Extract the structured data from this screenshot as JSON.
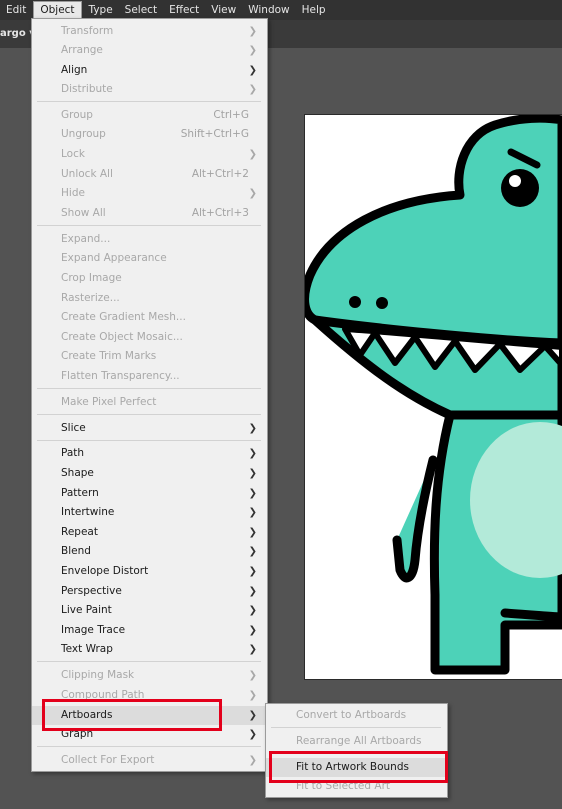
{
  "menubar": {
    "items": [
      "Edit",
      "Object",
      "Type",
      "Select",
      "Effect",
      "View",
      "Window",
      "Help"
    ],
    "active": "Object"
  },
  "document_tab": {
    "label": "argo v"
  },
  "object_menu": {
    "transform": "Transform",
    "arrange": "Arrange",
    "align": "Align",
    "distribute": "Distribute",
    "group": "Group",
    "group_sc": "Ctrl+G",
    "ungroup": "Ungroup",
    "ungroup_sc": "Shift+Ctrl+G",
    "lock": "Lock",
    "unlock_all": "Unlock All",
    "unlock_all_sc": "Alt+Ctrl+2",
    "hide": "Hide",
    "show_all": "Show All",
    "show_all_sc": "Alt+Ctrl+3",
    "expand": "Expand...",
    "expand_appearance": "Expand Appearance",
    "crop_image": "Crop Image",
    "rasterize": "Rasterize...",
    "create_gradient_mesh": "Create Gradient Mesh...",
    "create_object_mosaic": "Create Object Mosaic...",
    "create_trim_marks": "Create Trim Marks",
    "flatten_transparency": "Flatten Transparency...",
    "make_pixel_perfect": "Make Pixel Perfect",
    "slice": "Slice",
    "path": "Path",
    "shape": "Shape",
    "pattern": "Pattern",
    "intertwine": "Intertwine",
    "repeat": "Repeat",
    "blend": "Blend",
    "envelope_distort": "Envelope Distort",
    "perspective": "Perspective",
    "live_paint": "Live Paint",
    "image_trace": "Image Trace",
    "text_wrap": "Text Wrap",
    "clipping_mask": "Clipping Mask",
    "compound_path": "Compound Path",
    "artboards": "Artboards",
    "graph": "Graph",
    "collect_for_export": "Collect For Export"
  },
  "artboards_submenu": {
    "convert": "Convert to Artboards",
    "rearrange": "Rearrange All Artboards",
    "fit_artwork": "Fit to Artwork Bounds",
    "fit_selected": "Fit to Selected Art"
  },
  "colors": {
    "highlight_box": "#e3001b",
    "dino_body": "#4dd2b8",
    "dino_belly": "#b3ead9",
    "outline": "#000000"
  }
}
